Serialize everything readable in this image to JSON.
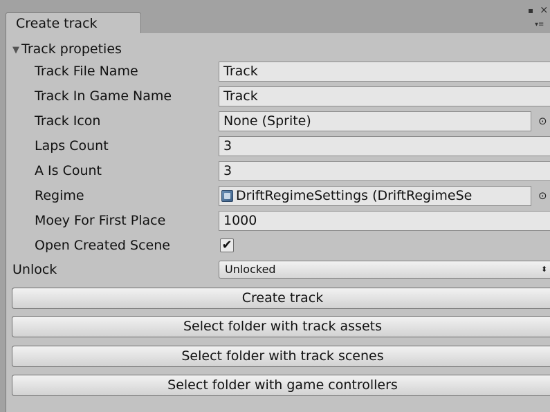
{
  "window": {
    "tab_title": "Create track",
    "maximize_glyph": "▪",
    "close_glyph": "×",
    "menu_glyph": "▾≡"
  },
  "foldout": {
    "arrow": "▼",
    "label": "Track propeties"
  },
  "fields": {
    "track_file_name": {
      "label": "Track File Name",
      "value": "Track"
    },
    "track_in_game_name": {
      "label": "Track In Game Name",
      "value": "Track"
    },
    "track_icon": {
      "label": "Track Icon",
      "value": "None (Sprite)"
    },
    "laps_count": {
      "label": "Laps Count",
      "value": "3"
    },
    "ais_count": {
      "label": "A Is Count",
      "value": "3"
    },
    "regime": {
      "label": "Regime",
      "value": "DriftRegimeSettings (DriftRegimeSe"
    },
    "money_first_place": {
      "label": "Moey For First Place",
      "value": "1000"
    },
    "open_created_scene": {
      "label": "Open Created Scene",
      "checked": true,
      "glyph": "✔"
    }
  },
  "unlock": {
    "label": "Unlock",
    "value": "Unlocked",
    "arrow": "⬍"
  },
  "picker_glyph": "⊙",
  "buttons": {
    "create_track": "Create track",
    "select_assets": "Select folder with track assets",
    "select_scenes": "Select folder with track scenes",
    "select_controllers": "Select folder with game controllers"
  }
}
